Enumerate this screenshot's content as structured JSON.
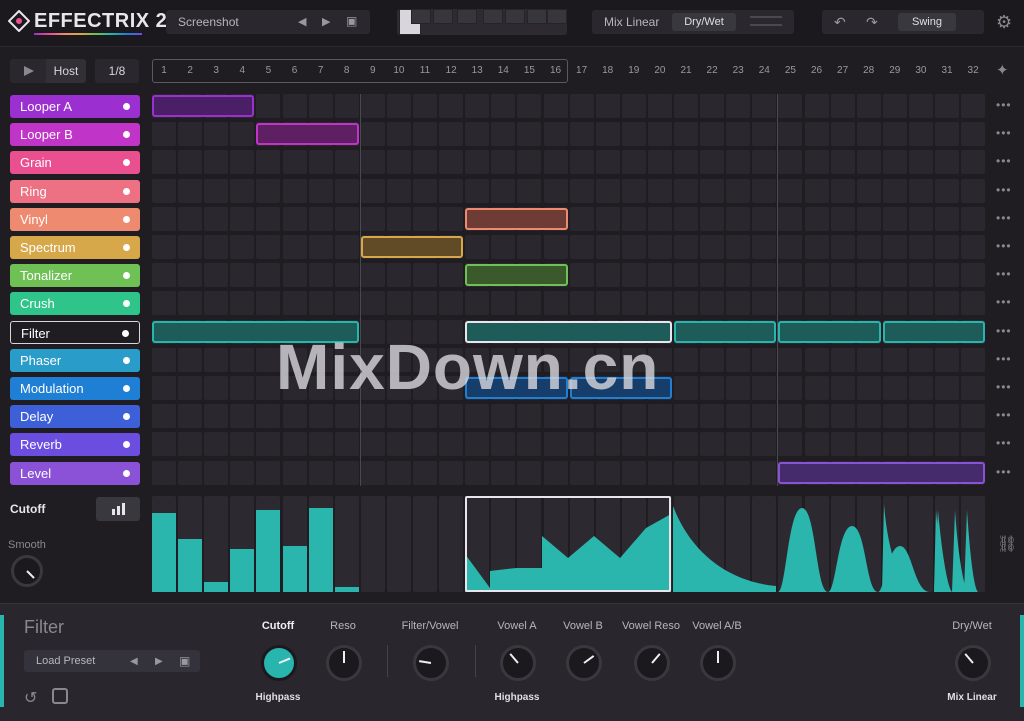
{
  "app": {
    "name": "EFFECTRIX 2"
  },
  "topbar": {
    "preset": "Screenshot",
    "mix_mode": "Mix Linear",
    "dry_wet_label": "Dry/Wet",
    "swing_label": "Swing"
  },
  "transport": {
    "sync": "Host",
    "division": "1/8"
  },
  "steps": [
    "1",
    "2",
    "3",
    "4",
    "5",
    "6",
    "7",
    "8",
    "9",
    "10",
    "11",
    "12",
    "13",
    "14",
    "15",
    "16",
    "17",
    "18",
    "19",
    "20",
    "21",
    "22",
    "23",
    "24",
    "25",
    "26",
    "27",
    "28",
    "29",
    "30",
    "31",
    "32"
  ],
  "effects": [
    {
      "name": "Looper A",
      "color": "#9b2fd0"
    },
    {
      "name": "Looper B",
      "color": "#c035c8"
    },
    {
      "name": "Grain",
      "color": "#ea4f90"
    },
    {
      "name": "Ring",
      "color": "#ee7183"
    },
    {
      "name": "Vinyl",
      "color": "#ee8a70"
    },
    {
      "name": "Spectrum",
      "color": "#d6a84a"
    },
    {
      "name": "Tonalizer",
      "color": "#6fc156"
    },
    {
      "name": "Crush",
      "color": "#2ec48a"
    },
    {
      "name": "Filter",
      "color": "#28b5ad"
    },
    {
      "name": "Phaser",
      "color": "#2a9cc9"
    },
    {
      "name": "Modulation",
      "color": "#1f7fd4"
    },
    {
      "name": "Delay",
      "color": "#3d5fd8"
    },
    {
      "name": "Reverb",
      "color": "#6b4ee0"
    },
    {
      "name": "Level",
      "color": "#8b52d8"
    }
  ],
  "selected_effect": "Filter",
  "blocks": [
    {
      "row": 0,
      "start": 1,
      "end": 4,
      "fill": "#4b1f66",
      "border": "#9b2fd0"
    },
    {
      "row": 1,
      "start": 5,
      "end": 8,
      "fill": "#5e1f63",
      "border": "#c035c8"
    },
    {
      "row": 4,
      "start": 13,
      "end": 16,
      "fill": "#6e3c35",
      "border": "#ee8a70"
    },
    {
      "row": 5,
      "start": 9,
      "end": 12,
      "fill": "#604b26",
      "border": "#d6a84a"
    },
    {
      "row": 6,
      "start": 13,
      "end": 16,
      "fill": "#3a5a2c",
      "border": "#6fc156"
    },
    {
      "row": 8,
      "start": 1,
      "end": 8,
      "fill": "#1d5c58",
      "border": "#28b5ad"
    },
    {
      "row": 8,
      "start": 13,
      "end": 20,
      "fill": "#1d5c58",
      "border": "#e8e6ec"
    },
    {
      "row": 8,
      "start": 21,
      "end": 24,
      "fill": "#1d5c58",
      "border": "#28b5ad"
    },
    {
      "row": 8,
      "start": 25,
      "end": 28,
      "fill": "#1d5c58",
      "border": "#28b5ad"
    },
    {
      "row": 8,
      "start": 29,
      "end": 32,
      "fill": "#1d5c58",
      "border": "#28b5ad"
    },
    {
      "row": 10,
      "start": 13,
      "end": 16,
      "fill": "#173e6a",
      "border": "#1f7fd4"
    },
    {
      "row": 10,
      "start": 17,
      "end": 20,
      "fill": "#173e6a",
      "border": "#1f7fd4"
    },
    {
      "row": 13,
      "start": 25,
      "end": 32,
      "fill": "#452a6c",
      "border": "#8b52d8"
    }
  ],
  "modulation": {
    "param_label": "Cutoff",
    "smooth_label": "Smooth",
    "step_values": [
      0.82,
      0.55,
      0.1,
      0.45,
      0.85,
      0.48,
      0.88,
      0.05,
      0,
      0,
      0,
      0,
      0.3,
      0.2,
      0.25,
      0.55,
      0.5,
      0.8,
      0.65,
      0.85
    ]
  },
  "panel": {
    "title": "Filter",
    "load_preset": "Load Preset",
    "knobs": [
      {
        "label": "Cutoff",
        "sub": "Highpass",
        "value": 0.75,
        "active": true
      },
      {
        "label": "Reso",
        "sub": "",
        "value": 0.5,
        "active": false
      },
      {
        "label": "Filter/Vowel",
        "sub": "",
        "value": 0.2,
        "active": false
      },
      {
        "label": "Vowel A",
        "sub": "Highpass",
        "value": 0.35,
        "active": false
      },
      {
        "label": "Vowel B",
        "sub": "",
        "value": 0.7,
        "active": false
      },
      {
        "label": "Vowel Reso",
        "sub": "",
        "value": 0.65,
        "active": false
      },
      {
        "label": "Vowel A/B",
        "sub": "",
        "value": 0.5,
        "active": false
      },
      {
        "label": "Dry/Wet",
        "sub": "Mix Linear",
        "value": 0.35,
        "active": false
      }
    ]
  },
  "accent": "#28b5ad"
}
